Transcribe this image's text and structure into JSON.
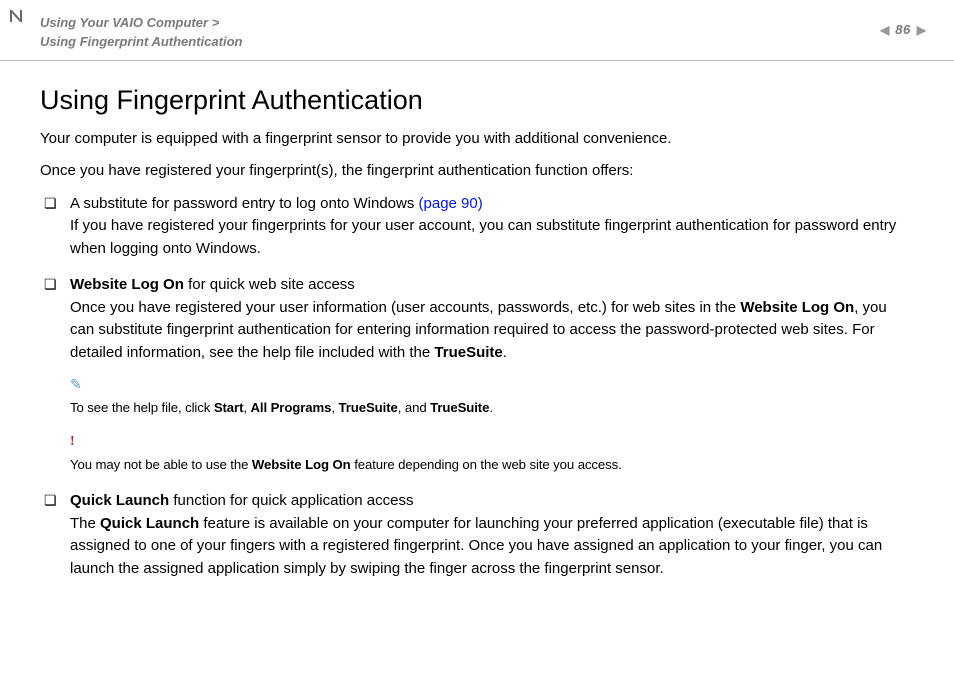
{
  "header": {
    "breadcrumb_parent": "Using Your VAIO Computer",
    "breadcrumb_sep": ">",
    "breadcrumb_child": "Using Fingerprint Authentication",
    "page_number": "86"
  },
  "title": "Using Fingerprint Authentication",
  "intro1": "Your computer is equipped with a fingerprint sensor to provide you with additional convenience.",
  "intro2": "Once you have registered your fingerprint(s), the fingerprint authentication function offers:",
  "items": [
    {
      "lead": "A substitute for password entry to log onto Windows ",
      "link": "(page 90)",
      "body": "If you have registered your fingerprints for your user account, you can substitute fingerprint authentication for password entry when logging onto Windows."
    },
    {
      "bold_lead": "Website Log On",
      "after_bold": " for quick web site access",
      "body_pre": "Once you have registered your user information (user accounts, passwords, etc.) for web sites in the ",
      "body_bold": "Website Log On",
      "body_post": ", you can substitute fingerprint authentication for entering information required to access the password-protected web sites. For detailed information, see the help file included with the ",
      "body_bold2": "TrueSuite",
      "body_end": "."
    },
    {
      "bold_lead": "Quick Launch",
      "after_bold": " function for quick application access",
      "body_pre": "The ",
      "body_bold": "Quick Launch",
      "body_post": " feature is available on your computer for launching your preferred application (executable file) that is assigned to one of your fingers with a registered fingerprint. Once you have assigned an application to your finger, you can launch the assigned application simply by swiping the finger across the fingerprint sensor."
    }
  ],
  "note_info": {
    "pre": "To see the help file, click ",
    "b1": "Start",
    "s1": ", ",
    "b2": "All Programs",
    "s2": ", ",
    "b3": "TrueSuite",
    "s3": ", and ",
    "b4": "TrueSuite",
    "end": "."
  },
  "note_warn": {
    "pre": "You may not be able to use the ",
    "b1": "Website Log On",
    "post": " feature depending on the web site you access."
  },
  "icons": {
    "pencil": "✎",
    "bang": "!"
  }
}
